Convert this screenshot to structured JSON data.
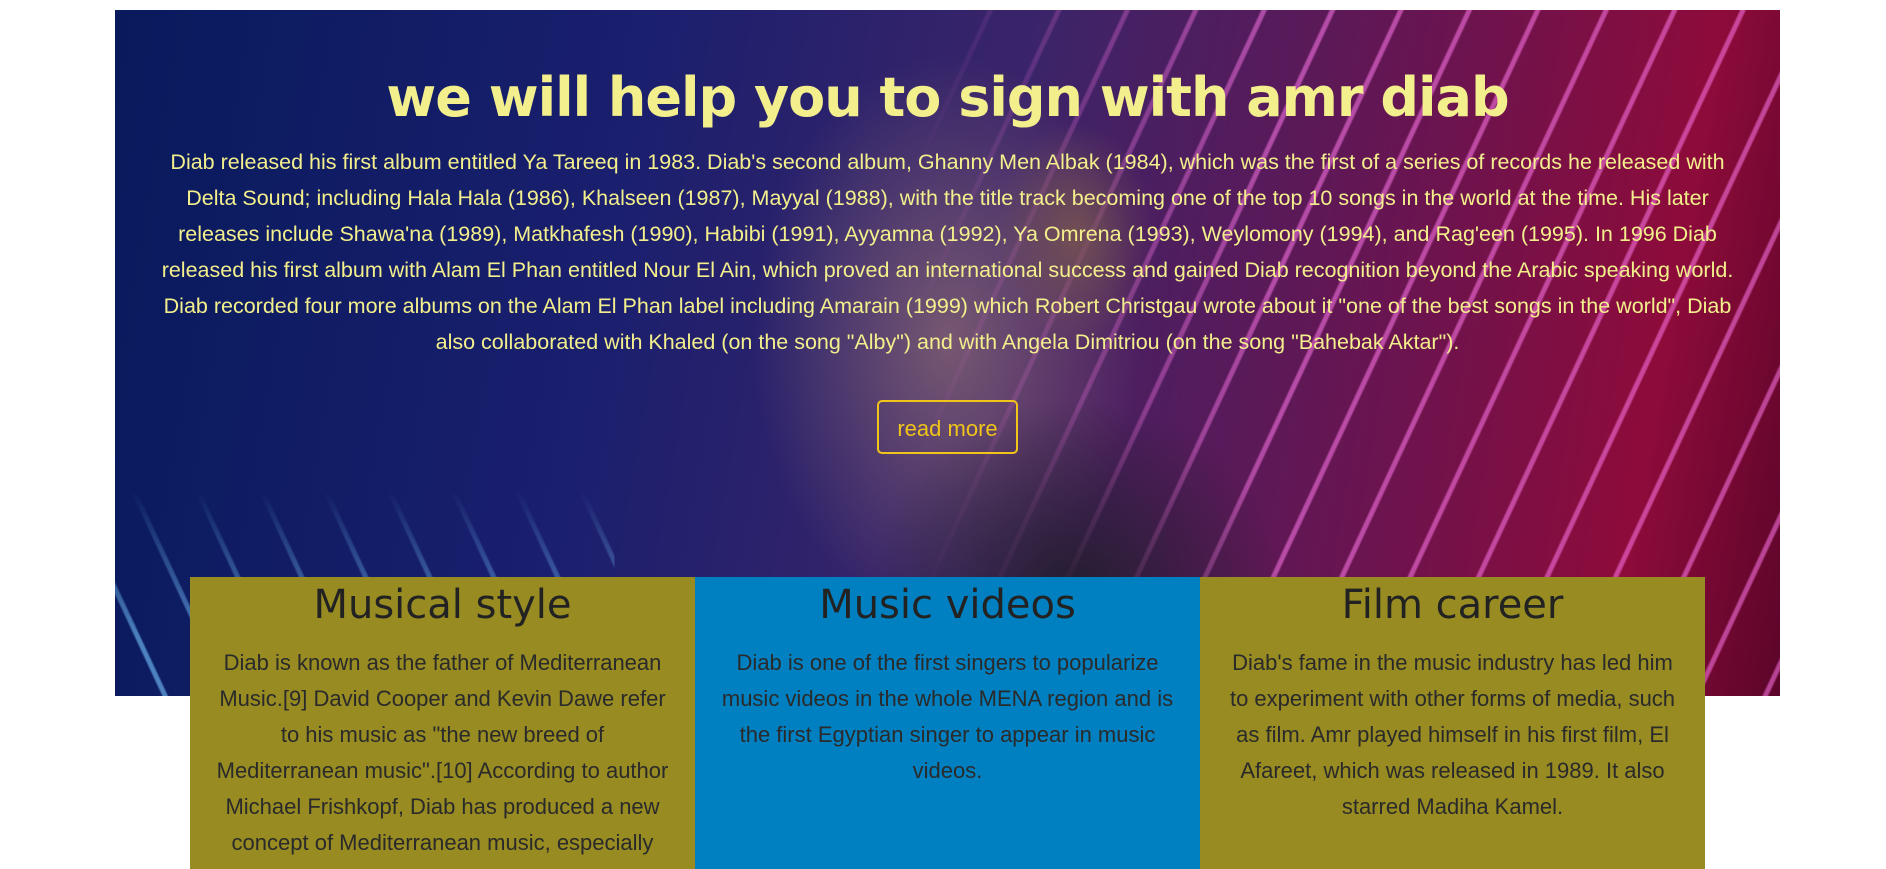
{
  "hero": {
    "title": "we will help you to sign with amr diab",
    "text": "Diab released his first album entitled Ya Tareeq in 1983. Diab's second album, Ghanny Men Albak (1984), which was the first of a series of records he released with Delta Sound; including Hala Hala (1986), Khalseen (1987), Mayyal (1988), with the title track becoming one of the top 10 songs in the world at the time. His later releases include Shawa'na (1989), Matkhafesh (1990), Habibi (1991), Ayyamna (1992), Ya Omrena (1993), Weylomony (1994), and Rag'een (1995). In 1996 Diab released his first album with Alam El Phan entitled Nour El Ain, which proved an international success and gained Diab recognition beyond the Arabic speaking world. Diab recorded four more albums on the Alam El Phan label including Amarain (1999) which Robert Christgau wrote about it \"one of the best songs in the world\", Diab also collaborated with Khaled (on the song \"Alby\") and with Angela Dimitriou (on the song \"Bahebak Aktar\").",
    "button_label": "read more"
  },
  "cards": [
    {
      "title": "Musical style",
      "text": "Diab is known as the father of Mediterranean Music.[9] David Cooper and Kevin Dawe refer to his music as \"the new breed of Mediterranean music\".[10] According to author Michael Frishkopf, Diab has produced a new concept of Mediterranean music, especially with his",
      "bg": "#978b22"
    },
    {
      "title": "Music videos",
      "text": "Diab is one of the first singers to popularize music videos in the whole MENA region and is the first Egyptian singer to appear in music videos.",
      "bg": "#0080c0"
    },
    {
      "title": "Film career",
      "text": "Diab's fame in the music industry has led him to experiment with other forms of media, such as film. Amr played himself in his first film, El Afareet, which was released in 1989. It also starred Madiha Kamel.",
      "bg": "#978b22"
    }
  ],
  "colors": {
    "hero_text": "#f3ef8c",
    "button_border": "#f0c419"
  }
}
